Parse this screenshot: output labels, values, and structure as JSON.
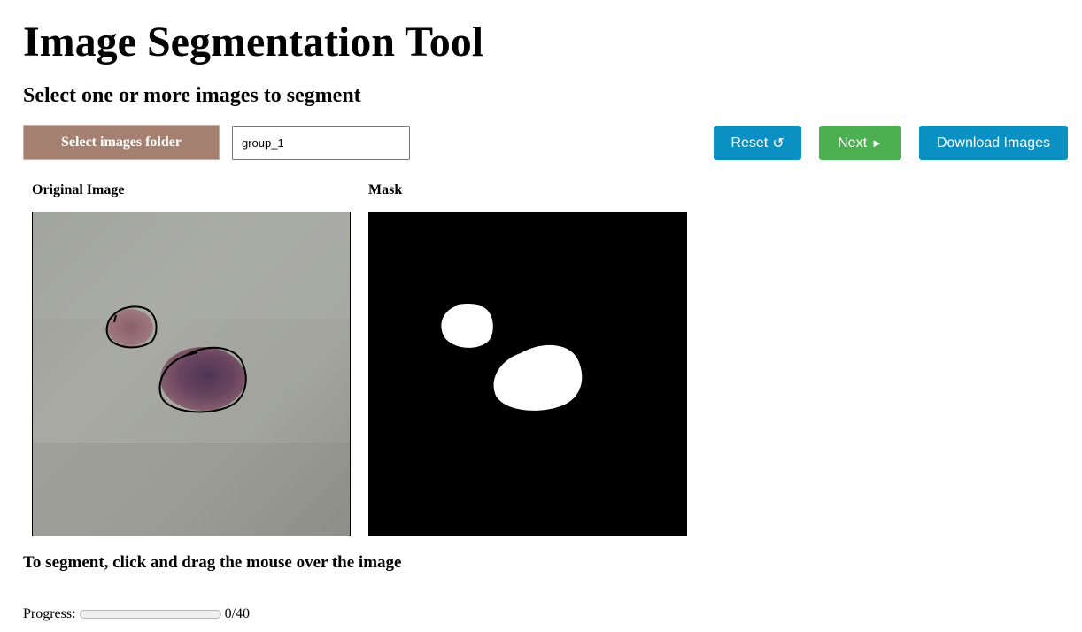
{
  "page": {
    "title": "Image Segmentation Tool",
    "subtitle": "Select one or more images to segment"
  },
  "controls": {
    "folder_button_label": "Select images folder",
    "group_value": "group_1",
    "reset_label": "Reset",
    "reset_icon": "↺",
    "next_label": "Next",
    "next_icon": "►",
    "download_label": "Download Images"
  },
  "panels": {
    "original_label": "Original Image",
    "mask_label": "Mask"
  },
  "instructions": "To segment, click and drag the mouse over the image",
  "progress": {
    "label": "Progress:",
    "current": 0,
    "total": 40,
    "text": "0/40"
  },
  "colors": {
    "folder_button": "#a58070",
    "reset_button": "#0b90c3",
    "next_button": "#4caf50",
    "download_button": "#0b90c3",
    "mask_background": "#000000",
    "mask_foreground": "#ffffff",
    "outline_stroke": "#000000"
  }
}
